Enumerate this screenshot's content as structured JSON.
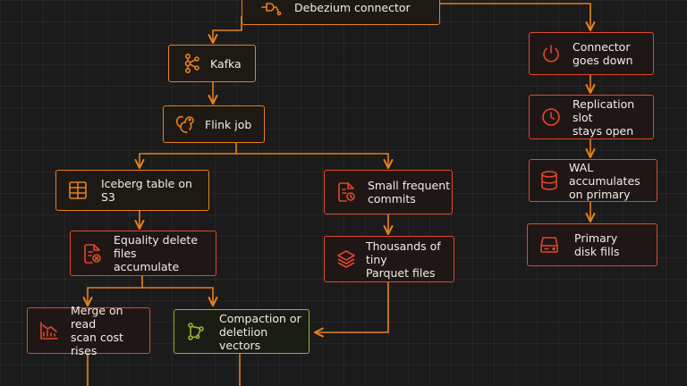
{
  "colors": {
    "orange": "#e8801c",
    "red": "#e2472c",
    "green": "#8fb635",
    "background": "#1b1b1b",
    "text": "#f2ede6"
  },
  "nodes": {
    "debezium": {
      "label": "Debezium connector",
      "icon": "plug-icon"
    },
    "kafka": {
      "label": "Kafka",
      "icon": "kafka-icon"
    },
    "flink": {
      "label": "Flink job",
      "icon": "squirrel-icon"
    },
    "iceberg": {
      "label": "Iceberg table on S3",
      "icon": "table-icon"
    },
    "small_commits": {
      "label": "Small frequent\ncommits",
      "icon": "file-clock-icon"
    },
    "equality_deletes": {
      "label": "Equality delete files\naccumulate",
      "icon": "file-x-icon"
    },
    "tiny_files": {
      "label": "Thousands of tiny\nParquet files",
      "icon": "layers-icon"
    },
    "merge_on_read": {
      "label": "Merge on read\nscan cost rises",
      "icon": "chart-down-icon"
    },
    "compaction": {
      "label": "Compaction or\ndeletiion vectors",
      "icon": "graph-icon"
    },
    "connector_down": {
      "label": "Connector\ngoes down",
      "icon": "power-icon"
    },
    "replication_slot": {
      "label": "Replication slot\nstays open",
      "icon": "clock-icon"
    },
    "wal": {
      "label": "WAL accumulates\non primary",
      "icon": "database-icon"
    },
    "disk_full": {
      "label": "Primary\ndisk fills",
      "icon": "hard-drive-icon"
    }
  }
}
